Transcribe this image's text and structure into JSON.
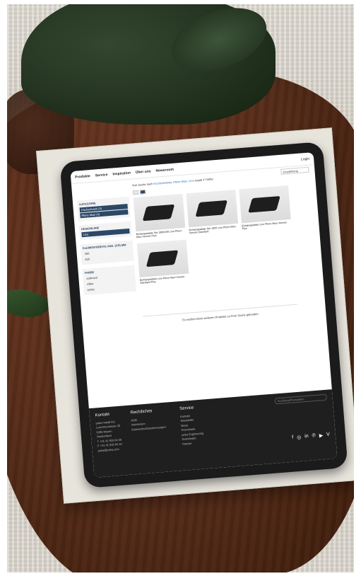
{
  "nav": {
    "items": [
      "Produkte",
      "Service",
      "Inspiration",
      "Über uns",
      "Newsroom"
    ],
    "login": "Login"
  },
  "search": {
    "prefix": "Ihre Suche nach",
    "query": "Hochschränke, Pleno Maxi, Lino",
    "suffix": "ergab 4 Treffer",
    "sort": "Empfehlung"
  },
  "sidebar": {
    "facets": [
      {
        "title": "KATEGORIE",
        "options": [
          {
            "label": "Hochschrank (4)",
            "selected": true
          },
          {
            "label": "Pleno Maxi (4)",
            "selected": true
          }
        ]
      },
      {
        "title": "DESIGNLINIE",
        "options": [
          {
            "label": "Lino",
            "selected": true
          }
        ]
      },
      {
        "title": "ELEMENTBREITE ANS. (CR) MM",
        "options": [
          {
            "label": "450",
            "selected": false
          },
          {
            "label": "450",
            "selected": false
          }
        ]
      },
      {
        "title": "FARBE",
        "options": [
          {
            "label": "anthrazit",
            "selected": false
          },
          {
            "label": "silber",
            "selected": false
          },
          {
            "label": "weiss",
            "selected": false
          }
        ]
      }
    ]
  },
  "products": [
    {
      "title": "Einhängetablar Set 1900/400 Lino Pleno Maxi Version Plus"
    },
    {
      "title": "Einhängetablar-Set 1900 Lino Pleno Maxi Version Standard"
    },
    {
      "title": "Einhängetablar Lino Pleno Maxi Version Plus"
    },
    {
      "title": "Einhängetablar Lino Pleno Maxi Version Standard Plus"
    }
  ],
  "no_more": "Es wurden keine weiteren Produkte zu Ihrer Suche gefunden.",
  "footer": {
    "kontakt": {
      "heading": "Kontakt",
      "lines": [
        "peka-metall AG",
        "Luzernerstrasse 20",
        "6295 Mosen",
        "Switzerland",
        "T +41 41 919 84 00",
        "F +41 41 919 84 10",
        "peka@peka.com"
      ]
    },
    "rechtliches": {
      "heading": "Rechtliches",
      "lines": [
        "AGB",
        "Impressum",
        "Datenschutzbestimmungen"
      ]
    },
    "service": {
      "heading": "Service",
      "lines": [
        "Kontakt",
        "Newsletter",
        "News",
        "Downloads",
        "peka Engineering",
        "Downloads",
        "Partner"
      ]
    },
    "search_placeholder": "Suchbegriff eingeben",
    "social": [
      "f",
      "◎",
      "in",
      "℗",
      "▶",
      "V"
    ]
  }
}
